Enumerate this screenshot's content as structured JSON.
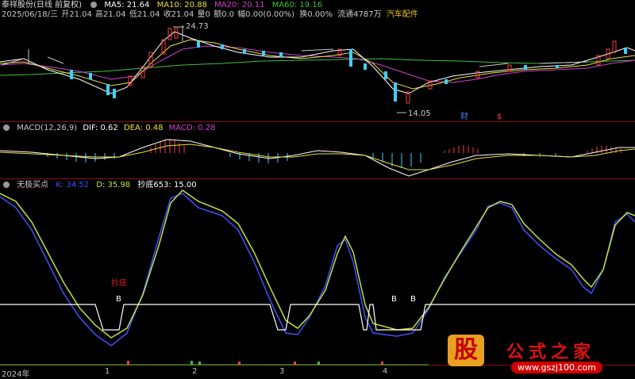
{
  "header": {
    "line1": {
      "title": "泰祥股份(日线 前复权)",
      "ma5": "MA5: 21.64",
      "ma10": "MA10: 20.88",
      "ma20": "MA20: 20.11",
      "ma60": "MA60: 19.16"
    },
    "line2": {
      "date": "2025/06/18/三",
      "open": "开21.04",
      "high": "高21.04",
      "low": "低21.04",
      "close": "收21.04",
      "vol": "量0",
      "amount": "额0.0",
      "change": "幅0.00(0.00%)",
      "turnover": "换0.00%",
      "float": "流通4787万",
      "sector": "汽车配件"
    },
    "high_label": "24.73",
    "low_label": "14.05",
    "markers": [
      "财",
      "$"
    ]
  },
  "macd": {
    "name": "MACD(12,26,9)",
    "dif": "DIF: 0.62",
    "dea": "DEA: 0.48",
    "macd": "MACD: 0.28"
  },
  "indicator": {
    "name": "无极买点",
    "k": "K: 34.52",
    "d": "D: 35.98",
    "chaodi": "抄底653: 15.00",
    "annotation": "抄底",
    "b_labels": [
      "B",
      "B",
      "B"
    ]
  },
  "xaxis": [
    "2024年",
    "1",
    "2",
    "3",
    "4"
  ],
  "logo": {
    "mark": "股",
    "brand": "公式之家",
    "url": "www.gszj100.com"
  },
  "colors": {
    "ma5": "#ffffff",
    "ma10": "#e8e040",
    "ma20": "#d040d0",
    "ma60": "#40c040",
    "up": "#ff4040",
    "down": "#40d0ff",
    "k": "#4050ff",
    "d": "#c0e040",
    "line": "#ffffff",
    "separator": "#8a1010"
  }
}
